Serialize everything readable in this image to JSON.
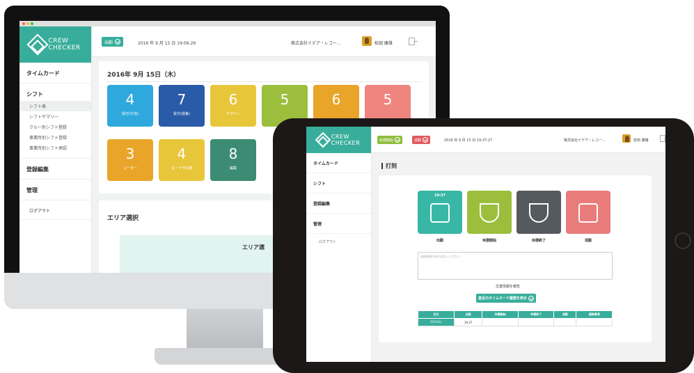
{
  "brand": {
    "logo_line1": "CREW",
    "logo_line2": "CHECKER"
  },
  "desktop": {
    "header": {
      "status_button": "出勤",
      "datetime": "2016 年 9 月 15 日 19:09:29",
      "company": "株式会社イデア・レコー…",
      "user": "松田 康雄"
    },
    "sidebar": {
      "timecard": "タイムカード",
      "shift": "シフト",
      "shift_items": [
        "シフト表",
        "シフトサマリー",
        "クルー別シフト登録",
        "事業所別シフト登録",
        "事業所別シフト承認"
      ],
      "registration": "登録編集",
      "management": "管理",
      "logout": "ログアウト"
    },
    "date_title": "2016年 9月 15日（木）",
    "tiles": [
      {
        "value": "4",
        "label": "受付(午前)",
        "color": "#2fa9dd"
      },
      {
        "value": "7",
        "label": "受付(遅番)",
        "color": "#2a5ba8"
      },
      {
        "value": "6",
        "label": "デザイン",
        "color": "#e8c63a"
      },
      {
        "value": "5",
        "label": "",
        "color": "#9bbf3c"
      },
      {
        "value": "6",
        "label": "",
        "color": "#e8a52a"
      },
      {
        "value": "5",
        "label": "",
        "color": "#ee857e"
      },
      {
        "value": "3",
        "label": "コーダー",
        "color": "#e8a52a"
      },
      {
        "value": "4",
        "label": "企・デザ応援",
        "color": "#e8c63a"
      },
      {
        "value": "8",
        "label": "編集",
        "color": "#3b8c73"
      }
    ],
    "area_title": "エリア選択",
    "area_label": "エリア選"
  },
  "tablet": {
    "header": {
      "break_start_button": "休憩開始",
      "leave_button": "退勤",
      "datetime": "2016 年 9 月 15 日 19:37:27",
      "company": "株式会社イデア・レコー…",
      "user": "松田 康雄"
    },
    "sidebar": {
      "timecard": "タイムカード",
      "shift": "シフト",
      "registration": "登録編集",
      "management": "管理",
      "logout": "ログアウト"
    },
    "page_title": "打刻",
    "stamps": [
      {
        "label": "出勤",
        "time": "19:37",
        "color": "#39b7a6",
        "icon": "clock-in-icon"
      },
      {
        "label": "休憩開始",
        "time": "",
        "color": "#9bbf3c",
        "icon": "coffee-cup-icon"
      },
      {
        "label": "休憩終了",
        "time": "",
        "color": "#555a5e",
        "icon": "empty-cup-icon"
      },
      {
        "label": "退勤",
        "time": "",
        "color": "#ea7b7b",
        "icon": "clock-out-icon"
      }
    ],
    "memo_placeholder": "連絡事項があれば記入ください。",
    "report_label": "位置情報を報告",
    "history_button": "直近のタイムカード履歴を表示",
    "table": {
      "headers": [
        "日付",
        "出勤",
        "休憩開始",
        "休憩終了",
        "退勤",
        "連絡事項"
      ],
      "rows": [
        [
          "9/15(木)",
          "19:37",
          "",
          "",
          "",
          ""
        ]
      ]
    }
  }
}
